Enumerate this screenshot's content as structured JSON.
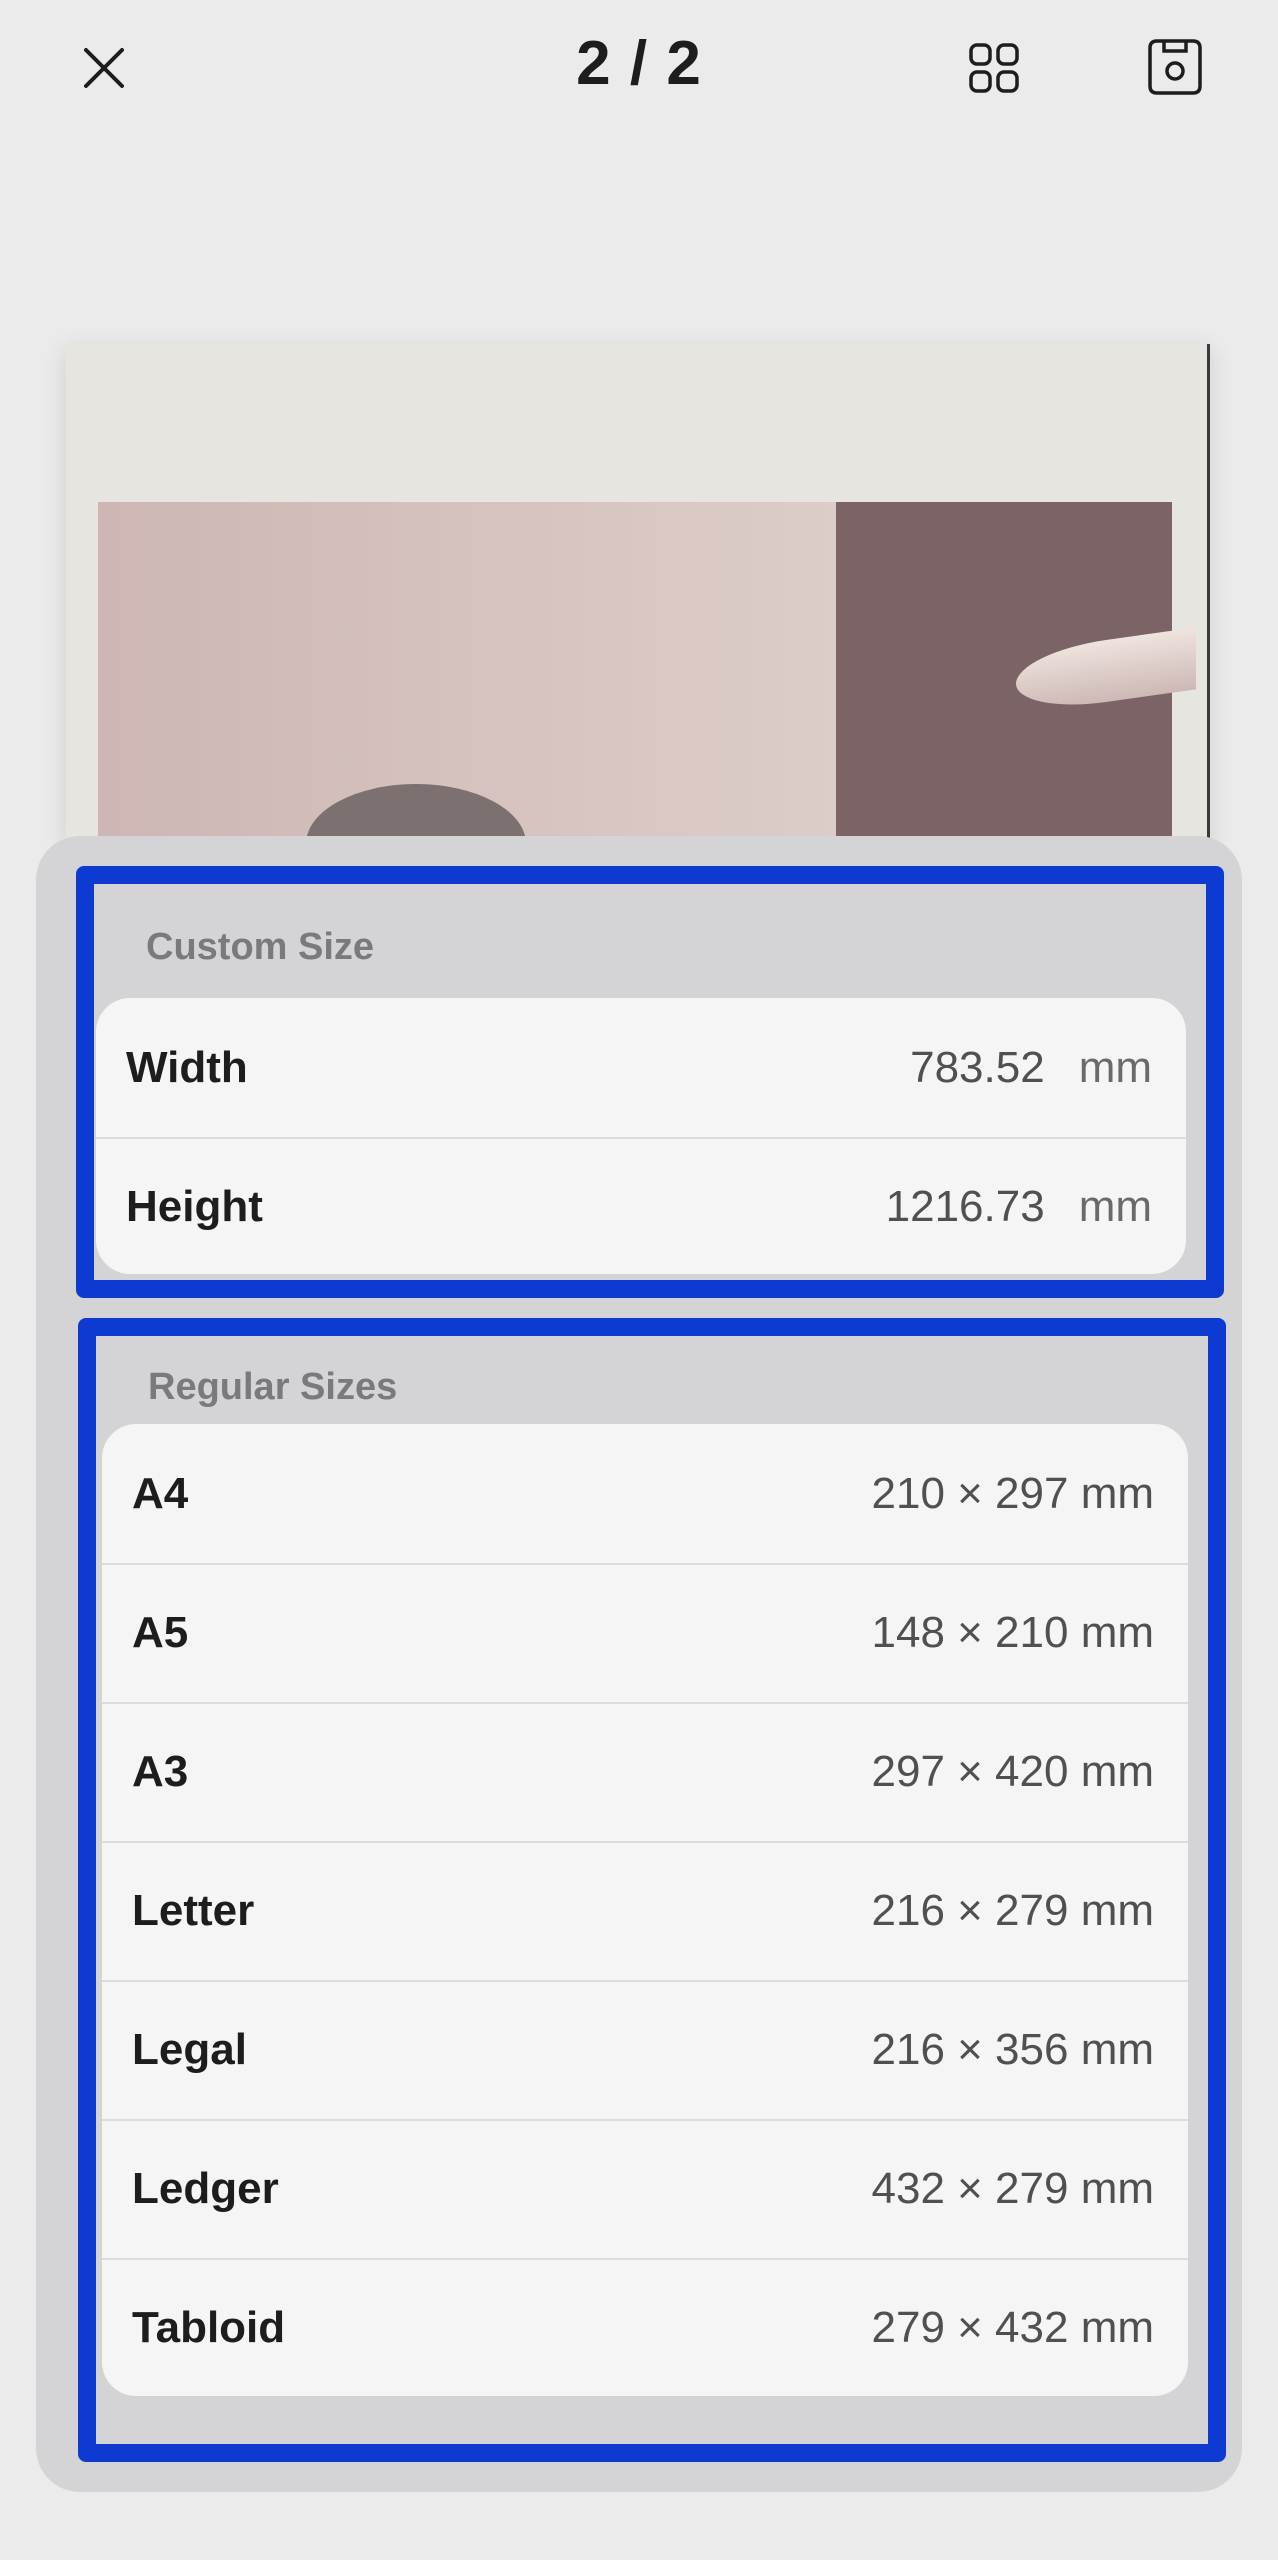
{
  "header": {
    "page_counter": "2 / 2",
    "icons": {
      "close": "close-icon",
      "grid": "grid-icon",
      "save": "save-icon"
    }
  },
  "custom_size": {
    "title": "Custom Size",
    "width": {
      "label": "Width",
      "value": "783.52",
      "unit": "mm"
    },
    "height": {
      "label": "Height",
      "value": "1216.73",
      "unit": "mm"
    }
  },
  "regular_sizes": {
    "title": "Regular Sizes",
    "items": [
      {
        "label": "A4",
        "value": "210 × 297 mm"
      },
      {
        "label": "A5",
        "value": "148 × 210 mm"
      },
      {
        "label": "A3",
        "value": "297 × 420 mm"
      },
      {
        "label": "Letter",
        "value": "216 × 279 mm"
      },
      {
        "label": "Legal",
        "value": "216 × 356 mm"
      },
      {
        "label": "Ledger",
        "value": "432 × 279 mm"
      },
      {
        "label": "Tabloid",
        "value": "279 × 432 mm"
      }
    ]
  },
  "colors": {
    "highlight_border": "#0d3bd1",
    "sheet_bg": "#d4d4d6",
    "card_bg": "#f5f5f5"
  }
}
